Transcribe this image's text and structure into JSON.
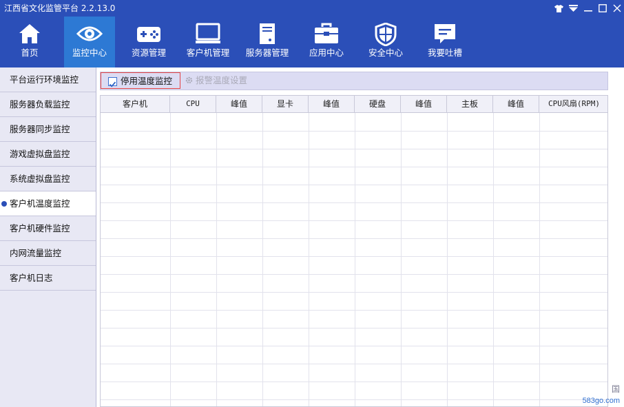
{
  "window": {
    "title": "江西省文化监管平台 2.2.13.0",
    "controls": [
      "shirt-icon",
      "dropdown-icon",
      "minimize-icon",
      "maximize-icon",
      "close-icon"
    ]
  },
  "nav": {
    "items": [
      {
        "label": "首页",
        "icon": "home-icon"
      },
      {
        "label": "监控中心",
        "icon": "eye-icon",
        "active": true
      },
      {
        "label": "资源管理",
        "icon": "gamepad-icon"
      },
      {
        "label": "客户机管理",
        "icon": "monitor-icon"
      },
      {
        "label": "服务器管理",
        "icon": "server-icon"
      },
      {
        "label": "应用中心",
        "icon": "toolbox-icon"
      },
      {
        "label": "安全中心",
        "icon": "shield-icon"
      },
      {
        "label": "我要吐槽",
        "icon": "feedback-icon"
      }
    ]
  },
  "sidebar": {
    "items": [
      {
        "label": "平台运行环境监控"
      },
      {
        "label": "服务器负载监控"
      },
      {
        "label": "服务器同步监控"
      },
      {
        "label": "游戏虚拟盘监控"
      },
      {
        "label": "系统虚拟盘监控"
      },
      {
        "label": "客户机温度监控",
        "active": true
      },
      {
        "label": "客户机硬件监控"
      },
      {
        "label": "内网流量监控"
      },
      {
        "label": "客户机日志"
      }
    ]
  },
  "toolbar": {
    "checkbox_label": "停用温度监控",
    "checkbox_checked": true,
    "settings_label": "报警温度设置"
  },
  "table": {
    "columns": [
      "客户机",
      "CPU",
      "峰值",
      "显卡",
      "峰值",
      "硬盘",
      "峰值",
      "主板",
      "峰值",
      "CPU风扇(RPM)"
    ],
    "rows": []
  },
  "watermark": {
    "site": "583go.com",
    "char": "国"
  },
  "colors": {
    "header_bg": "#2b4fb8",
    "active_nav_bg": "#2d79d4",
    "sidebar_bg": "#e8e8f4",
    "toolbar_bg": "#dcdcf3",
    "highlight_border": "#e44444"
  }
}
